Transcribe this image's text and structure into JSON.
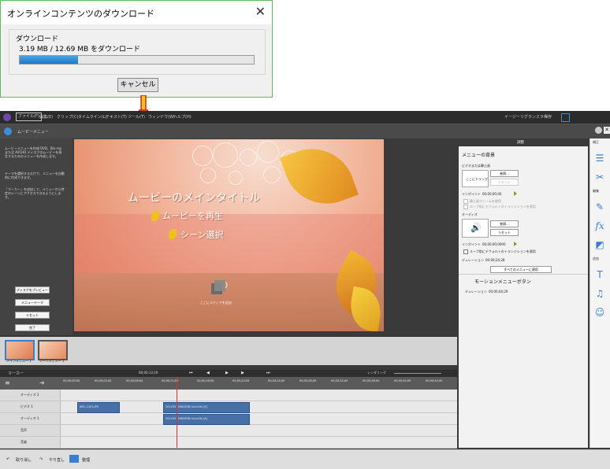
{
  "dialog": {
    "title": "オンラインコンテンツのダウンロード",
    "close": "✕",
    "section_label": "ダウンロード",
    "progress_text": "3.19 MB / 12.69 MB をダウンロード",
    "progress_fraction": 0.25,
    "cancel_label": "キャンセル"
  },
  "app": {
    "menu": {
      "items": [
        "ファイル(F)",
        "編集(E)",
        "クリップ(C)",
        "タイムライン(L)",
        "テキスト(T)",
        "ツール(T)",
        "ウィンドウ(W)",
        "ヘルプ(H)"
      ],
      "right_items": [
        "イージーリグランスラー",
        "保存"
      ]
    },
    "panel_title": "ムービーメニュー",
    "help_icon": "?",
    "close_icon": "✕",
    "left": {
      "info1": "ムービーメニューを作成 DVD、Blu-ray または AVCHD ディスクのムービーを再生するためのメニューを作成します。",
      "info2": "テーマを選択するだけで、メニューを自動的に作成できます。",
      "info3": "「マーカー」を追加して、メニューから特定のシーンにアクセスできるようにします。",
      "buttons": [
        "ディスクをプレビュー",
        "メニューテーマ",
        "リセット",
        "完了"
      ]
    },
    "preview": {
      "main_title": "ムービーのメインタイトル",
      "menu_item_1": "ムービーを再生",
      "menu_item_2": "シーン選択",
      "drop_label": "ここにメディアを追加"
    },
    "thumbnails": [
      {
        "label": "メインメニュー 1"
      },
      {
        "label": "シーンメニュー 1"
      }
    ],
    "timeline": {
      "marker_label": "マーカー",
      "timecode": "00;00;13;19",
      "render_label": "レンダリング",
      "ruler": [
        "00;00;00;00",
        "00;00;04;00",
        "00;00;08;00",
        "00;00;12;00",
        "00;00;16;00",
        "00;00;20;00",
        "00;00;24;00",
        "00;00;28;00",
        "00;00;32;00",
        "00;00;36;00",
        "00;00;40;00",
        "00;00;44;00"
      ],
      "tracks": [
        {
          "name": "オーディオ 2"
        },
        {
          "name": "ビデオ 1",
          "clips": [
            {
              "label": "IMG_1421.JPG"
            },
            {
              "label": "20120515084838-hd.m2ts [V]"
            }
          ]
        },
        {
          "name": "オーディオ 1",
          "clips": [
            {
              "label": "20120515084838-hd.m2ts [A]"
            }
          ]
        },
        {
          "name": "音声"
        },
        {
          "name": "音楽"
        }
      ]
    },
    "status": {
      "undo": "取り消し",
      "redo": "やり直し",
      "organize": "整理"
    },
    "properties": {
      "header": "調整",
      "menu_bg_section": "メニューの背景",
      "video_or_still": "ビデオまたは静止画",
      "drop_here": "ここにドラッグ",
      "browse": "参照...",
      "reset": "リセット",
      "in_point_label": "インポイント",
      "in_point_value": "00;00;00;00",
      "loop_still_frame": "静止画フレームを使用",
      "apply_transition_before_loop": "ループ前にデフォルトのトランジションを適用",
      "audio_label": "オーディオ",
      "audio_in_point_value": "00;00;00;0000",
      "audio_loop_transition": "ループ前にデフォルトのトランジションを適用",
      "duration_label": "デュレーション",
      "duration_value": "00;00;24;28",
      "apply_all": "すべてのメニューに適用",
      "motion_section": "モーションメニューボタン",
      "motion_duration_label": "デュレーション",
      "motion_duration_value": "00;00;04;29"
    },
    "right_tools": {
      "fix_label": "補正",
      "edit_label": "編集",
      "add_label": "追加",
      "icons": [
        "adjust-icon",
        "tools-icon",
        "effects-icon",
        "fx-icon",
        "transition-icon",
        "title-icon",
        "music-icon",
        "graphics-icon"
      ]
    }
  },
  "colors": {
    "accent": "#3a7fd0",
    "highlight_arrow": "#f0c020",
    "dialog_border": "#5fb85f",
    "progress_fill": "#1e78c8"
  }
}
